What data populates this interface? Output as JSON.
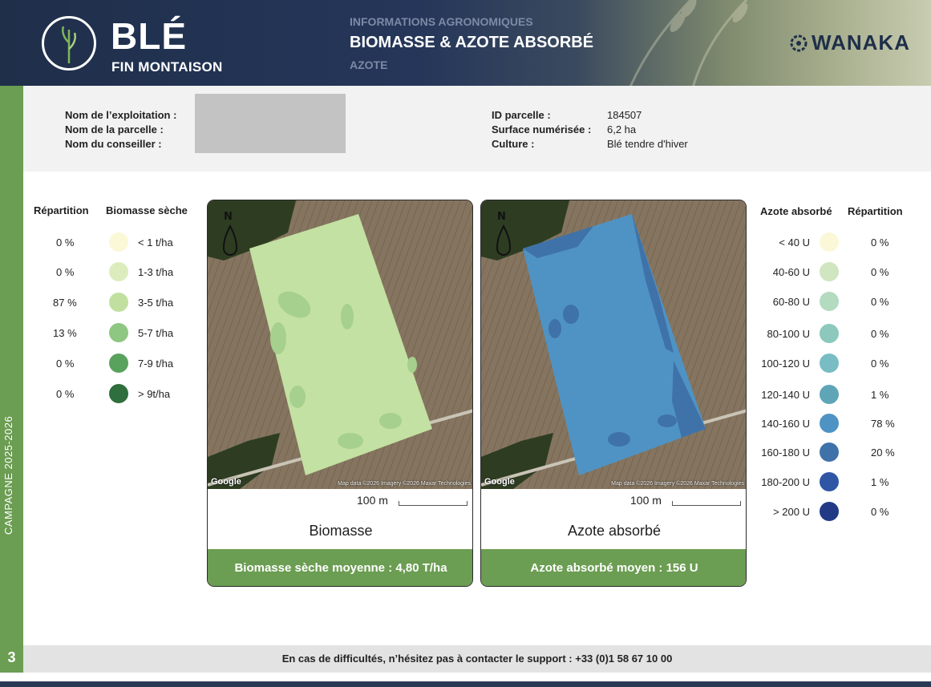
{
  "header": {
    "crop": "BLÉ",
    "stage": "FIN MONTAISON",
    "kicker": "INFORMATIONS AGRONOMIQUES",
    "title": "BIOMASSE & AZOTE ABSORBÉ",
    "subtitle": "AZOTE",
    "brand": "WANAKA",
    "logo_icon": "wheat-stalk-icon"
  },
  "sidebar": {
    "campaign": "CAMPAGNE 2025-2026",
    "page_number": "3"
  },
  "info": {
    "farm_label": "Nom de l’exploitation :",
    "parcel_label": "Nom de la parcelle :",
    "advisor_label": "Nom du conseiller :",
    "parcel_id_label": "ID parcelle :",
    "parcel_id_value": "184507",
    "surface_label": "Surface numérisée :",
    "surface_value": "6,2 ha",
    "culture_label": "Culture :",
    "culture_value": "Blé tendre d'hiver"
  },
  "biomass_legend": {
    "col_repartition": "Répartition",
    "col_biomass": "Biomasse sèche",
    "rows": [
      {
        "pct": "0 %",
        "range": "< 1 t/ha",
        "color": "#fbf8d8"
      },
      {
        "pct": "0 %",
        "range": "1-3 t/ha",
        "color": "#dcedbd"
      },
      {
        "pct": "87 %",
        "range": "3-5 t/ha",
        "color": "#c1e0a0"
      },
      {
        "pct": "13 %",
        "range": "5-7 t/ha",
        "color": "#8ec781"
      },
      {
        "pct": "0 %",
        "range": "7-9 t/ha",
        "color": "#58a25e"
      },
      {
        "pct": "0 %",
        "range": "> 9t/ha",
        "color": "#2f6e3d"
      }
    ]
  },
  "nitrogen_legend": {
    "col_nitrogen": "Azote absorbé",
    "col_repartition": "Répartition",
    "rows": [
      {
        "range": "< 40 U",
        "pct": "0 %",
        "color": "#fbf8d8"
      },
      {
        "range": "40-60 U",
        "pct": "0 %",
        "color": "#cfe6c0"
      },
      {
        "range": "60-80 U",
        "pct": "0 %",
        "color": "#b3dbc0"
      },
      {
        "range": "80-100 U",
        "pct": "0 %",
        "color": "#8cc8bb"
      },
      {
        "range": "100-120 U",
        "pct": "0 %",
        "color": "#78bdc4"
      },
      {
        "range": "120-140 U",
        "pct": "1 %",
        "color": "#5ea5b8"
      },
      {
        "range": "140-160 U",
        "pct": "78 %",
        "color": "#4f93c5"
      },
      {
        "range": "160-180 U",
        "pct": "20 %",
        "color": "#3f72a8"
      },
      {
        "range": "180-200 U",
        "pct": "1 %",
        "color": "#2f55a5"
      },
      {
        "range": "> 200 U",
        "pct": "0 %",
        "color": "#223a86"
      }
    ]
  },
  "biomass_card": {
    "scale": "100 m",
    "title": "Biomasse",
    "footer": "Biomasse sèche moyenne : 4,80 T/ha",
    "google": "Google",
    "credit": "Map data ©2026 Imagery ©2026 Maxar Technologies",
    "north": "N"
  },
  "nitrogen_card": {
    "scale": "100 m",
    "title": "Azote absorbé",
    "footer": "Azote absorbé moyen : 156 U",
    "google": "Google",
    "credit": "Map data ©2026 Imagery ©2026 Maxar Technologies",
    "north": "N"
  },
  "support": {
    "text": "En cas de difficultés, n’hésitez pas à contacter le support : +33 (0)1 58 67 10 00"
  }
}
